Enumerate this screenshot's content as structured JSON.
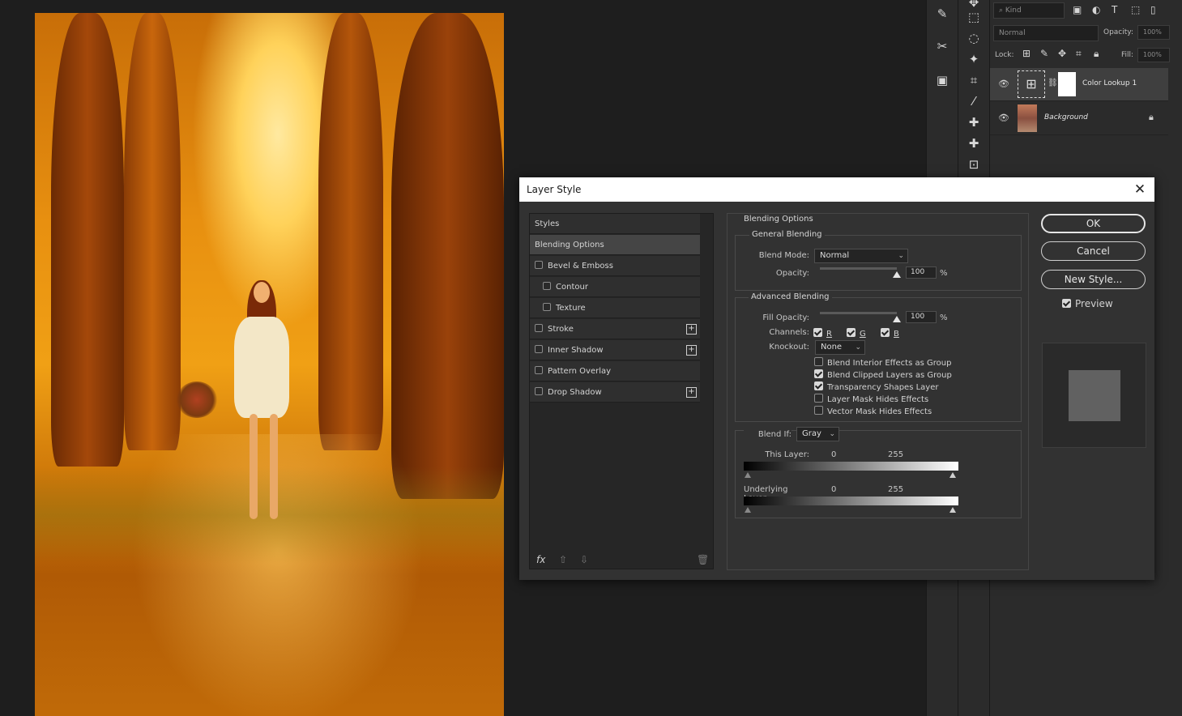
{
  "layers_panel": {
    "filter_kind": "Kind",
    "blend_mode": "Normal",
    "opacity_label": "Opacity:",
    "opacity_value": "100%",
    "lock_label": "Lock:",
    "fill_label": "Fill:",
    "fill_value": "100%",
    "layers": [
      {
        "name": "Color Lookup 1",
        "visible": true
      },
      {
        "name": "Background",
        "visible": true,
        "locked": true
      }
    ]
  },
  "dialog": {
    "title": "Layer Style",
    "styles_list": [
      {
        "label": "Styles",
        "type": "header"
      },
      {
        "label": "Blending Options",
        "type": "item",
        "active": true
      },
      {
        "label": "Bevel & Emboss",
        "type": "check",
        "checked": false
      },
      {
        "label": "Contour",
        "type": "check",
        "checked": false,
        "sub": true
      },
      {
        "label": "Texture",
        "type": "check",
        "checked": false,
        "sub": true
      },
      {
        "label": "Stroke",
        "type": "check",
        "checked": false,
        "plus": true
      },
      {
        "label": "Inner Shadow",
        "type": "check",
        "checked": false,
        "plus": true
      },
      {
        "label": "Pattern Overlay",
        "type": "check",
        "checked": false
      },
      {
        "label": "Drop Shadow",
        "type": "check",
        "checked": false,
        "plus": true
      }
    ],
    "footer_fx": "fx",
    "blending_options": {
      "title": "Blending Options",
      "general": {
        "title": "General Blending",
        "blend_mode_label": "Blend Mode:",
        "blend_mode_value": "Normal",
        "opacity_label": "Opacity:",
        "opacity_value": "100",
        "opacity_unit": "%",
        "opacity_fraction": 1.0
      },
      "advanced": {
        "title": "Advanced Blending",
        "fill_label": "Fill Opacity:",
        "fill_value": "100",
        "fill_unit": "%",
        "fill_fraction": 1.0,
        "channels_label": "Channels:",
        "channels": [
          {
            "label": "R",
            "checked": true
          },
          {
            "label": "G",
            "checked": true
          },
          {
            "label": "B",
            "checked": true
          }
        ],
        "knockout_label": "Knockout:",
        "knockout_value": "None",
        "options": [
          {
            "label": "Blend Interior Effects as Group",
            "checked": false
          },
          {
            "label": "Blend Clipped Layers as Group",
            "checked": true
          },
          {
            "label": "Transparency Shapes Layer",
            "checked": true
          },
          {
            "label": "Layer Mask Hides Effects",
            "checked": false
          },
          {
            "label": "Vector Mask Hides Effects",
            "checked": false
          }
        ]
      },
      "blend_if": {
        "label": "Blend If:",
        "value": "Gray",
        "this_layer_label": "This Layer:",
        "this_layer_min": "0",
        "this_layer_max": "255",
        "underlying_label": "Underlying Layer:",
        "underlying_min": "0",
        "underlying_max": "255"
      }
    },
    "buttons": {
      "ok": "OK",
      "cancel": "Cancel",
      "new_style": "New Style...",
      "preview_label": "Preview",
      "preview_checked": true
    }
  }
}
